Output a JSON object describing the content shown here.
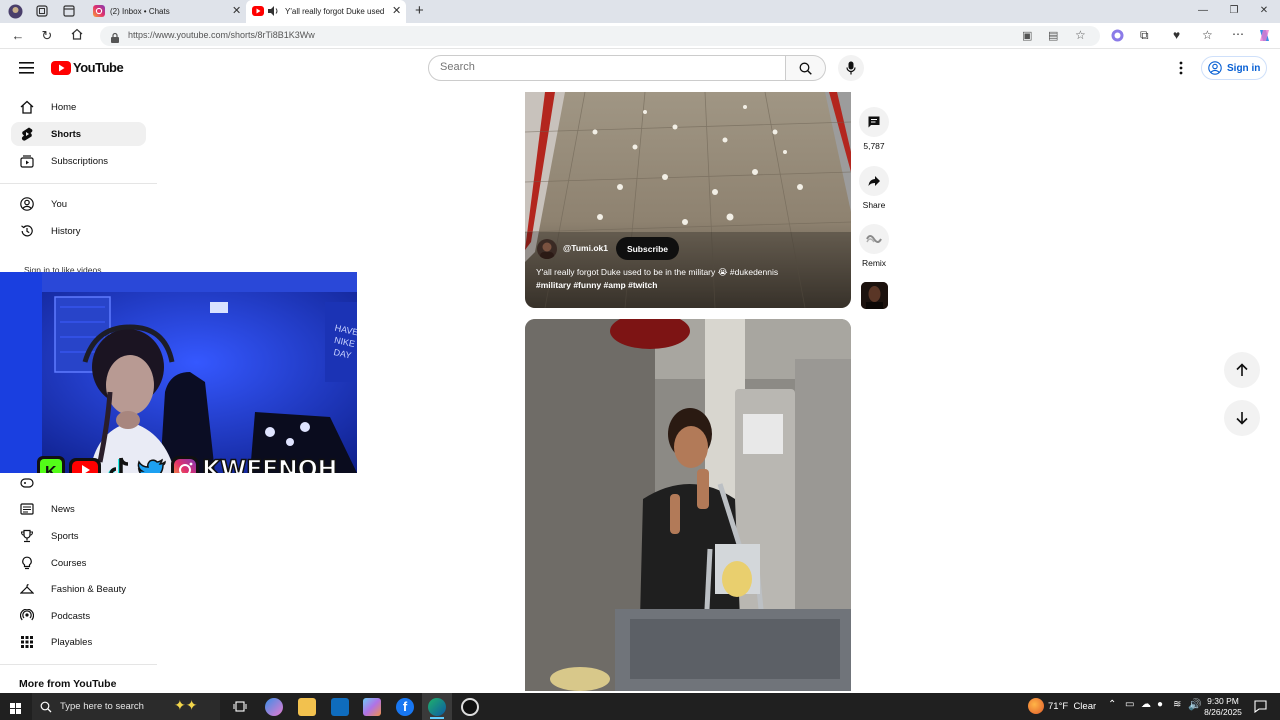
{
  "browser": {
    "tabs": [
      {
        "title": "(2) Inbox • Chats"
      },
      {
        "title": "Y'all really forgot Duke used"
      }
    ],
    "url": "https://www.youtube.com/shorts/8rTi8B1K3Ww"
  },
  "youtube": {
    "logo_text": "YouTube",
    "search_placeholder": "Search",
    "sign_in": "Sign in"
  },
  "sidebar": {
    "items_top": [
      {
        "label": "Home"
      },
      {
        "label": "Shorts"
      },
      {
        "label": "Subscriptions"
      }
    ],
    "items_you": [
      {
        "label": "You"
      },
      {
        "label": "History"
      }
    ],
    "sign_in_prompt": "Sign in to like videos",
    "explore": [
      {
        "label": "News"
      },
      {
        "label": "Sports"
      },
      {
        "label": "Courses"
      },
      {
        "label": "Fashion & Beauty"
      },
      {
        "label": "Podcasts"
      },
      {
        "label": "Playables"
      }
    ],
    "more_heading": "More from YouTube"
  },
  "short": {
    "channel": "@Tumi.ok1",
    "subscribe": "Subscribe",
    "caption_line1": "Y'all really forgot Duke used to be in the military 😭 #dukedennis",
    "caption_line2": "#military #funny  #amp #twitch",
    "comments_count": "5,787",
    "share_label": "Share",
    "remix_label": "Remix"
  },
  "overlay": {
    "streamer_name": "KWEENOH",
    "wall_text": "HAVE A NIKE DAY"
  },
  "taskbar": {
    "search_placeholder": "Type here to search",
    "weather": "71°F  Clear",
    "time": "9:30 PM",
    "date": "8/26/2025"
  },
  "colors": {
    "youtube_red": "#ff0000",
    "link_blue": "#065fd4",
    "webcam_blue": "#1633c9"
  }
}
